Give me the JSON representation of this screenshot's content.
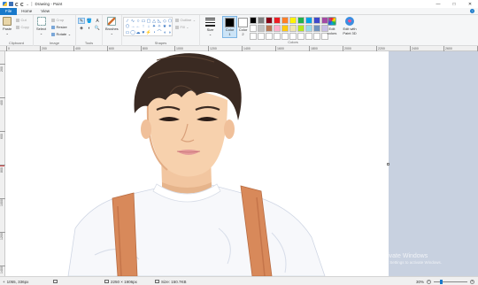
{
  "window": {
    "title": "Drawing - Paint",
    "controls": {
      "minimize": "—",
      "maximize": "□",
      "close": "✕"
    }
  },
  "menu": {
    "tabs": [
      "File",
      "Home",
      "View"
    ],
    "help": "?"
  },
  "ribbon": {
    "clipboard": {
      "paste": "Paste",
      "cut": "Cut",
      "copy": "Copy",
      "label": "Clipboard"
    },
    "image": {
      "select": "Select",
      "crop": "Crop",
      "resize": "Resize",
      "rotate": "Rotate",
      "label": "Image"
    },
    "tools": {
      "label": "Tools",
      "glyphs": [
        "✎",
        "🪣",
        "A",
        "◈",
        "◐",
        "🔍"
      ]
    },
    "brushes": {
      "label": "Brushes"
    },
    "shapes": {
      "label": "Shapes",
      "outline": "Outline",
      "fill": "Fill",
      "glyphs": [
        "∕",
        "∿",
        "○",
        "▭",
        "▢",
        "△",
        "◺",
        "◇",
        "⬠",
        "⬡",
        "→",
        "←",
        "↑",
        "↓",
        "✦",
        "✧",
        "★",
        "✶",
        "▭",
        "◯",
        "☁",
        "♥",
        "⚡",
        "◔",
        "⌒",
        "◖",
        "◗"
      ]
    },
    "size": {
      "label": "Size"
    },
    "colors": {
      "color1_label": "Color",
      "color1_sub": "1",
      "color2_label": "Color",
      "color2_sub": "2",
      "edit_colors": "Edit colors",
      "edit_paint3d": "Edit with Paint 3D",
      "label": "Colors",
      "color1": "#000000",
      "color2": "#ffffff",
      "palette": [
        "#000000",
        "#7f7f7f",
        "#880015",
        "#ed1c24",
        "#ff7f27",
        "#fff200",
        "#22b14c",
        "#00a2e8",
        "#3f48cc",
        "#a349a4",
        "#ffffff",
        "#c3c3c3",
        "#b97a57",
        "#ffaec9",
        "#ffc90e",
        "#efe4b0",
        "#b5e61d",
        "#99d9ea",
        "#7092be",
        "#c8bfe7",
        "#ffffff",
        "#ffffff",
        "#ffffff",
        "#ffffff",
        "#ffffff",
        "#ffffff",
        "#ffffff",
        "#ffffff",
        "#ffffff",
        "#ffffff"
      ]
    }
  },
  "ruler": {
    "top_ticks": [
      "0",
      "200",
      "400",
      "600",
      "800",
      "1000",
      "1200",
      "1400",
      "1600",
      "1800",
      "2000",
      "2200",
      "2400",
      "2600",
      "2800"
    ],
    "left_ticks": [
      "200",
      "400",
      "600",
      "800",
      "1000",
      "1200",
      "1400"
    ]
  },
  "watermark": {
    "line1": "Activate Windows",
    "line2": "Go to Settings to activate Windows."
  },
  "status": {
    "cursor_pos": "1055, 336px",
    "selection_size": "",
    "image_dims": "2250 × 1906px",
    "file_size": "Size: 150.7KB",
    "zoom": "30%",
    "zoom_level": 0.3
  }
}
